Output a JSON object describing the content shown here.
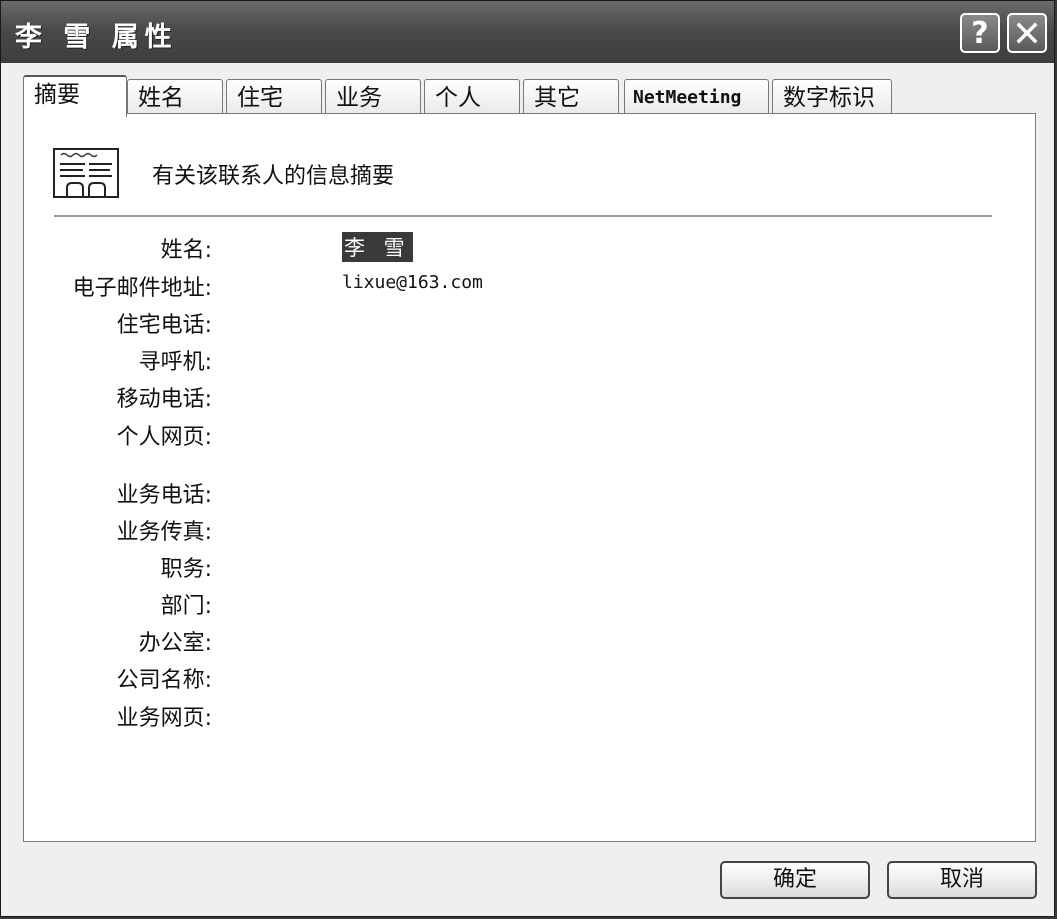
{
  "window": {
    "title": "李 雪 属性",
    "help_glyph": "?"
  },
  "tabs": [
    {
      "label": "摘要",
      "active": true
    },
    {
      "label": "姓名"
    },
    {
      "label": "住宅"
    },
    {
      "label": "业务"
    },
    {
      "label": "个人"
    },
    {
      "label": "其它"
    },
    {
      "label": "NetMeeting"
    },
    {
      "label": "数字标识"
    }
  ],
  "summary": {
    "description": "有关该联系人的信息摘要",
    "fields": [
      {
        "label": "姓名:",
        "value": "李 雪"
      },
      {
        "label": "电子邮件地址:",
        "value": "lixue@163.com"
      },
      {
        "label": "住宅电话:",
        "value": ""
      },
      {
        "label": "寻呼机:",
        "value": ""
      },
      {
        "label": "移动电话:",
        "value": ""
      },
      {
        "label": "个人网页:",
        "value": ""
      },
      {
        "label": "业务电话:",
        "value": ""
      },
      {
        "label": "业务传真:",
        "value": ""
      },
      {
        "label": "职务:",
        "value": ""
      },
      {
        "label": "部门:",
        "value": ""
      },
      {
        "label": "办公室:",
        "value": ""
      },
      {
        "label": "公司名称:",
        "value": ""
      },
      {
        "label": "业务网页:",
        "value": ""
      }
    ]
  },
  "buttons": {
    "ok": "确定",
    "cancel": "取消"
  }
}
